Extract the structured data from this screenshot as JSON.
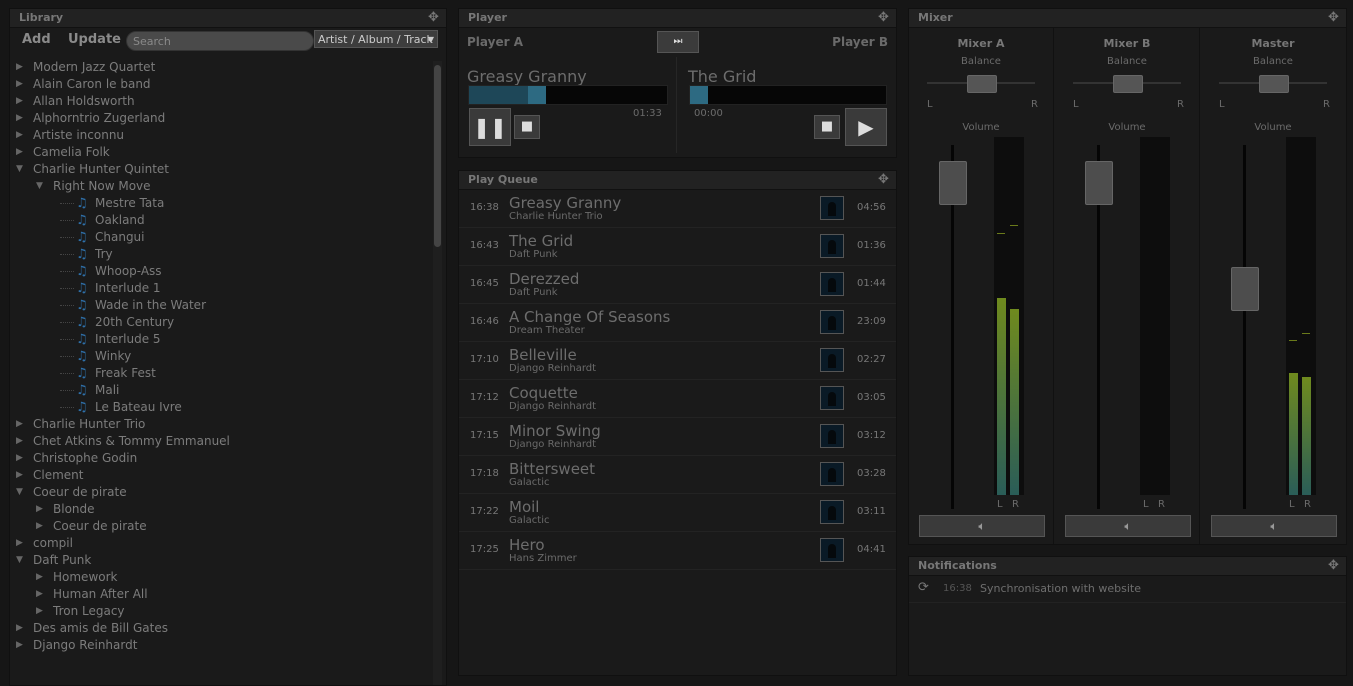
{
  "library": {
    "title": "Library",
    "add_label": "Add",
    "update_label": "Update",
    "search_placeholder": "Search",
    "filter_value": "Artist / Album / Track",
    "tree": [
      {
        "label": "Modern Jazz Quartet",
        "depth": 0,
        "type": "collapsed"
      },
      {
        "label": "Alain Caron le band",
        "depth": 0,
        "type": "collapsed"
      },
      {
        "label": "Allan Holdsworth",
        "depth": 0,
        "type": "collapsed"
      },
      {
        "label": "Alphorntrio Zugerland",
        "depth": 0,
        "type": "collapsed"
      },
      {
        "label": "Artiste inconnu",
        "depth": 0,
        "type": "collapsed"
      },
      {
        "label": "Camelia Folk",
        "depth": 0,
        "type": "collapsed"
      },
      {
        "label": "Charlie Hunter Quintet",
        "depth": 0,
        "type": "expanded"
      },
      {
        "label": "Right Now Move",
        "depth": 1,
        "type": "expanded"
      },
      {
        "label": "Mestre Tata",
        "depth": 2,
        "type": "track"
      },
      {
        "label": "Oakland",
        "depth": 2,
        "type": "track"
      },
      {
        "label": "Changui",
        "depth": 2,
        "type": "track"
      },
      {
        "label": "Try",
        "depth": 2,
        "type": "track"
      },
      {
        "label": "Whoop-Ass",
        "depth": 2,
        "type": "track"
      },
      {
        "label": "Interlude 1",
        "depth": 2,
        "type": "track"
      },
      {
        "label": "Wade in the Water",
        "depth": 2,
        "type": "track"
      },
      {
        "label": "20th Century",
        "depth": 2,
        "type": "track"
      },
      {
        "label": "Interlude 5",
        "depth": 2,
        "type": "track"
      },
      {
        "label": "Winky",
        "depth": 2,
        "type": "track"
      },
      {
        "label": "Freak Fest",
        "depth": 2,
        "type": "track"
      },
      {
        "label": "Mali",
        "depth": 2,
        "type": "track"
      },
      {
        "label": "Le Bateau Ivre",
        "depth": 2,
        "type": "track"
      },
      {
        "label": "Charlie Hunter Trio",
        "depth": 0,
        "type": "collapsed"
      },
      {
        "label": "Chet Atkins & Tommy Emmanuel",
        "depth": 0,
        "type": "collapsed"
      },
      {
        "label": "Christophe Godin",
        "depth": 0,
        "type": "collapsed"
      },
      {
        "label": "Clement",
        "depth": 0,
        "type": "collapsed"
      },
      {
        "label": "Coeur de pirate",
        "depth": 0,
        "type": "expanded"
      },
      {
        "label": "Blonde",
        "depth": 1,
        "type": "collapsed"
      },
      {
        "label": "Coeur de pirate",
        "depth": 1,
        "type": "collapsed"
      },
      {
        "label": "compil",
        "depth": 0,
        "type": "collapsed"
      },
      {
        "label": "Daft Punk",
        "depth": 0,
        "type": "expanded"
      },
      {
        "label": "Homework",
        "depth": 1,
        "type": "collapsed"
      },
      {
        "label": "Human After All",
        "depth": 1,
        "type": "collapsed"
      },
      {
        "label": "Tron Legacy",
        "depth": 1,
        "type": "collapsed"
      },
      {
        "label": "Des amis de Bill Gates",
        "depth": 0,
        "type": "collapsed"
      },
      {
        "label": "Django Reinhardt",
        "depth": 0,
        "type": "collapsed"
      }
    ]
  },
  "player": {
    "title": "Player",
    "player_a": {
      "label": "Player A",
      "track": "Greasy Granny",
      "time": "01:33",
      "progress": 0.39
    },
    "player_b": {
      "label": "Player B",
      "track": "The Grid",
      "time": "00:00",
      "progress": 0.0
    }
  },
  "queue": {
    "title": "Play Queue",
    "items": [
      {
        "time": "16:38",
        "title": "Greasy Granny",
        "artist": "Charlie Hunter Trio",
        "duration": "04:56"
      },
      {
        "time": "16:43",
        "title": "The Grid",
        "artist": "Daft Punk",
        "duration": "01:36"
      },
      {
        "time": "16:45",
        "title": "Derezzed",
        "artist": "Daft Punk",
        "duration": "01:44"
      },
      {
        "time": "16:46",
        "title": "A Change Of Seasons",
        "artist": "Dream Theater",
        "duration": "23:09"
      },
      {
        "time": "17:10",
        "title": "Belleville",
        "artist": "Django Reinhardt",
        "duration": "02:27"
      },
      {
        "time": "17:12",
        "title": "Coquette",
        "artist": "Django Reinhardt",
        "duration": "03:05"
      },
      {
        "time": "17:15",
        "title": "Minor Swing",
        "artist": "Django Reinhardt",
        "duration": "03:12"
      },
      {
        "time": "17:18",
        "title": "Bittersweet",
        "artist": "Galactic",
        "duration": "03:28"
      },
      {
        "time": "17:22",
        "title": "Moil",
        "artist": "Galactic",
        "duration": "03:11"
      },
      {
        "time": "17:25",
        "title": "Hero",
        "artist": "Hans Zimmer",
        "duration": "04:41"
      }
    ]
  },
  "mixer": {
    "title": "Mixer",
    "balance_label": "Balance",
    "volume_label": "Volume",
    "left_label": "L",
    "right_label": "R",
    "channels": [
      {
        "name": "Mixer A",
        "volume": 0.95,
        "level_l": 0.55,
        "level_r": 0.52,
        "peak_l": 0.73,
        "peak_r": 0.75
      },
      {
        "name": "Mixer B",
        "volume": 0.95,
        "level_l": 0.0,
        "level_r": 0.0,
        "peak_l": 0.0,
        "peak_r": 0.0
      },
      {
        "name": "Master",
        "volume": 0.62,
        "level_l": 0.34,
        "level_r": 0.33,
        "peak_l": 0.43,
        "peak_r": 0.45
      }
    ]
  },
  "notifications": {
    "title": "Notifications",
    "items": [
      {
        "time": "16:38",
        "message": "Synchronisation with website"
      }
    ]
  }
}
